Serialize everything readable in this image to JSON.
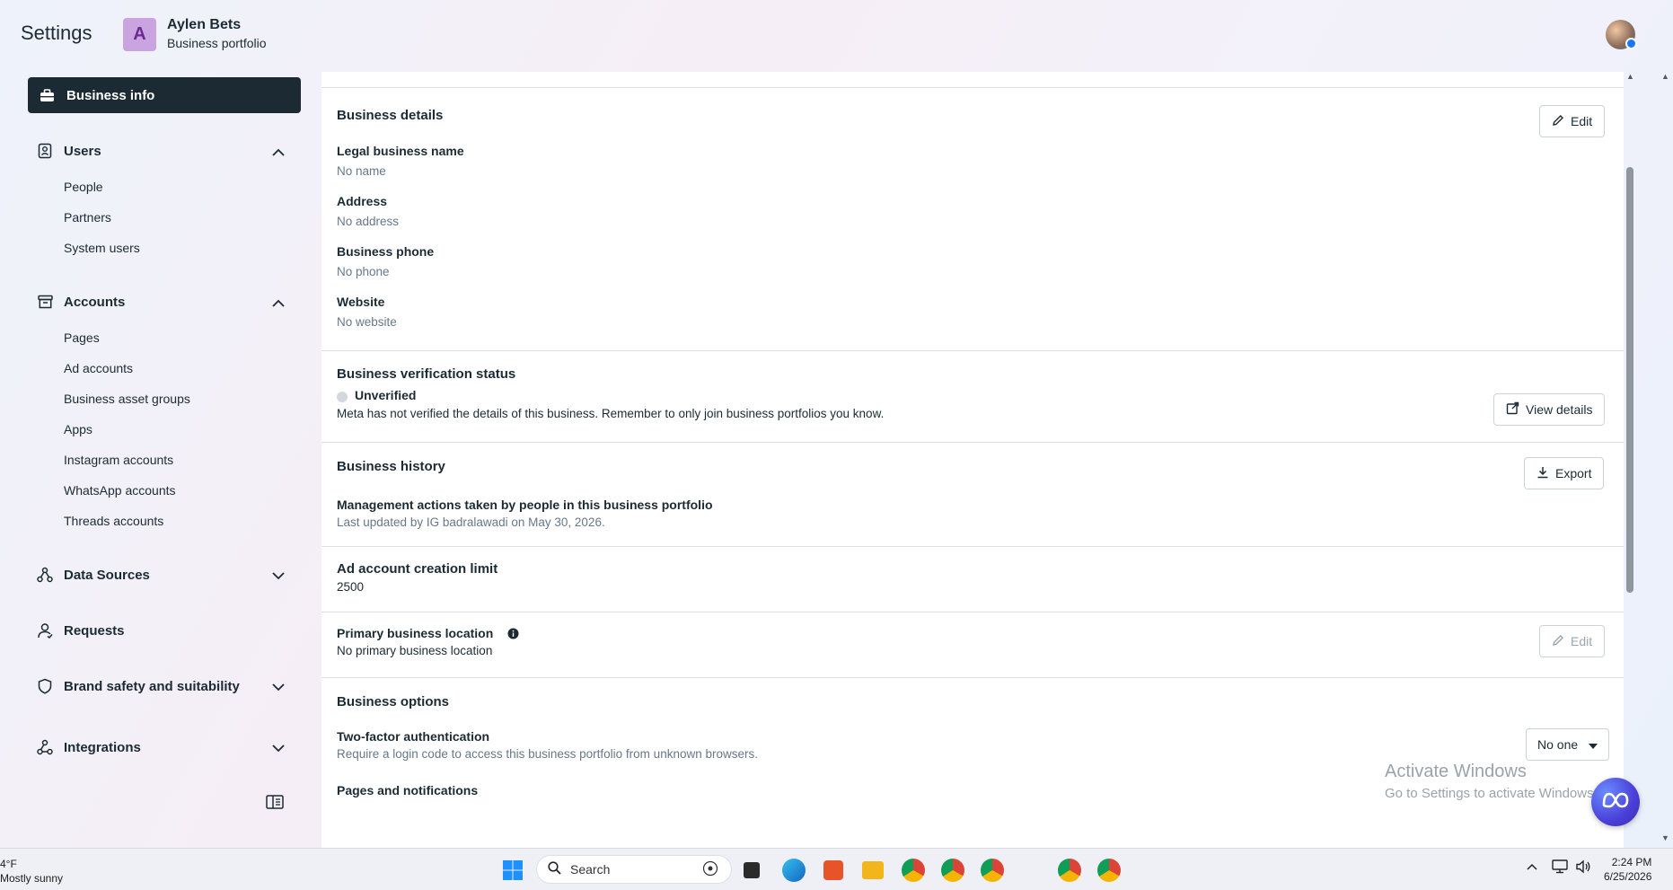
{
  "header": {
    "title": "Settings",
    "portfolio": {
      "initial": "A",
      "name": "Aylen Bets",
      "subtitle": "Business portfolio"
    }
  },
  "sidebar": {
    "active": {
      "label": "Business info",
      "icon": "briefcase-icon"
    },
    "sections": [
      {
        "label": "Users",
        "icon": "badge-icon",
        "expanded": true,
        "items": [
          "People",
          "Partners",
          "System users"
        ]
      },
      {
        "label": "Accounts",
        "icon": "archive-icon",
        "expanded": true,
        "items": [
          "Pages",
          "Ad accounts",
          "Business asset groups",
          "Apps",
          "Instagram accounts",
          "WhatsApp accounts",
          "Threads accounts"
        ]
      },
      {
        "label": "Data Sources",
        "icon": "data-sources-icon",
        "expanded": false
      },
      {
        "label": "Requests",
        "icon": "person-icon",
        "expanded": false
      },
      {
        "label": "Brand safety and suitability",
        "icon": "shield-icon",
        "expanded": false
      },
      {
        "label": "Integrations",
        "icon": "integrations-icon",
        "expanded": false
      }
    ]
  },
  "details": {
    "title": "Business details",
    "edit_label": "Edit",
    "fields": [
      {
        "label": "Legal business name",
        "value": "No name"
      },
      {
        "label": "Address",
        "value": "No address"
      },
      {
        "label": "Business phone",
        "value": "No phone"
      },
      {
        "label": "Website",
        "value": "No website"
      }
    ]
  },
  "verification": {
    "title": "Business verification status",
    "status": "Unverified",
    "description": "Meta has not verified the details of this business. Remember to only join business portfolios you know.",
    "button": "View details"
  },
  "history": {
    "title": "Business history",
    "button": "Export",
    "subtitle": "Management actions taken by people in this business portfolio",
    "updated": "Last updated by IG badralawadi on May 30, 2026."
  },
  "ad_limit": {
    "title": "Ad account creation limit",
    "value": "2500"
  },
  "location": {
    "title": "Primary business location",
    "value": "No primary business location",
    "button": "Edit"
  },
  "options": {
    "title": "Business options",
    "two_factor": {
      "label": "Two-factor authentication",
      "description": "Require a login code to access this business portfolio from unknown browsers.",
      "value": "No one"
    },
    "pages_notifications": {
      "label": "Pages and notifications"
    }
  },
  "activate_windows": {
    "line1": "Activate Windows",
    "line2": "Go to Settings to activate Windows."
  },
  "taskbar": {
    "weather": {
      "temp": "4°F",
      "condition": "Mostly sunny"
    },
    "search_placeholder": "Search",
    "time": "2:24 PM",
    "date": "6/25/2026"
  }
}
